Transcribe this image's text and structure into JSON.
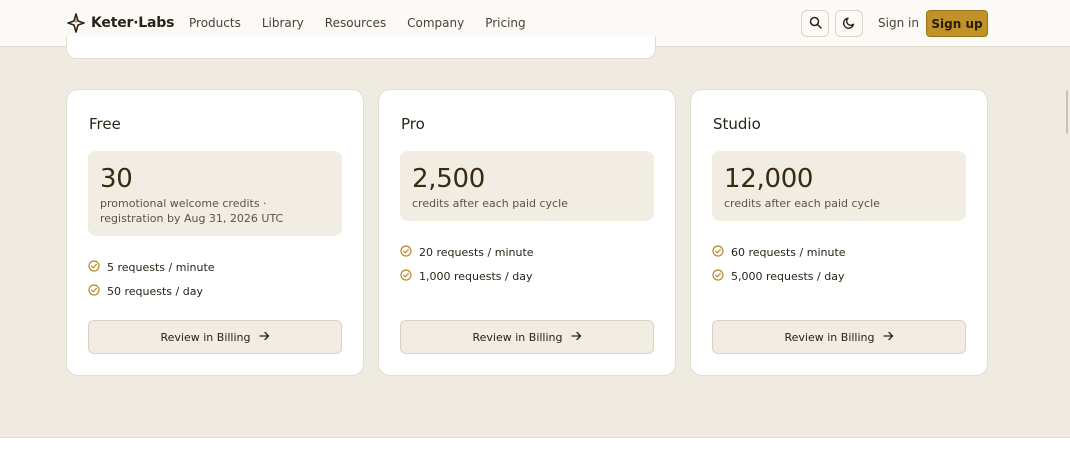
{
  "header": {
    "logo_text": "Keter·Labs",
    "nav": [
      "Products",
      "Library",
      "Resources",
      "Company",
      "Pricing"
    ],
    "sign_in": "Sign in",
    "sign_up": "Sign up",
    "icons": [
      "search-icon",
      "moon-icon"
    ]
  },
  "plans": [
    {
      "name": "Free",
      "credits": "30",
      "credits_desc": "promotional welcome credits · registration by Aug 31, 2026 UTC",
      "features": [
        "5 requests / minute",
        "50 requests / day"
      ],
      "button": "Review in Billing"
    },
    {
      "name": "Pro",
      "credits": "2,500",
      "credits_desc": "credits after each paid cycle",
      "features": [
        "20 requests / minute",
        "1,000 requests / day"
      ],
      "button": "Review in Billing"
    },
    {
      "name": "Studio",
      "credits": "12,000",
      "credits_desc": "credits after each paid cycle",
      "features": [
        "60 requests / minute",
        "5,000 requests / day"
      ],
      "button": "Review in Billing"
    }
  ],
  "colors": {
    "accent": "#c0922a",
    "background": "#efebe1",
    "card": "#ffffff",
    "credit_box": "#f1ede3",
    "check": "#b98a2a"
  }
}
